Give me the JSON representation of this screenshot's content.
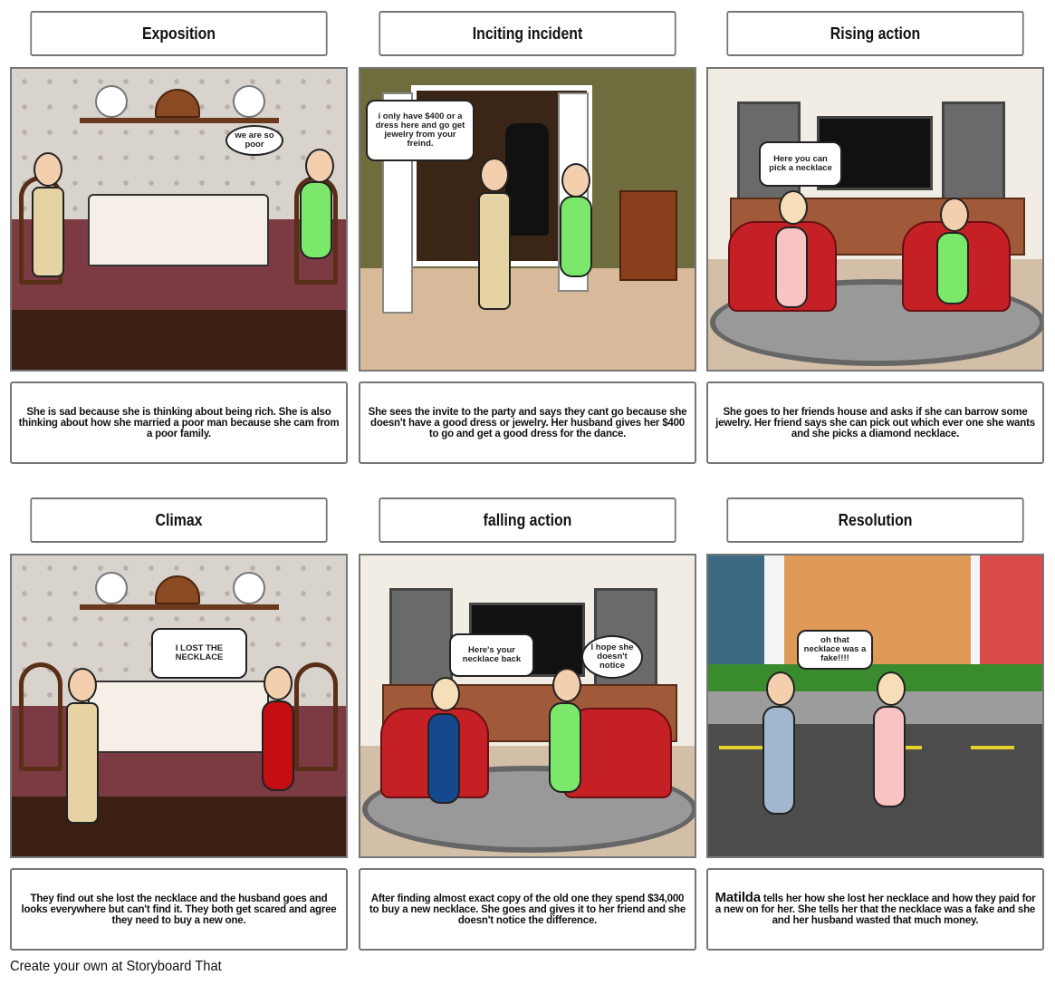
{
  "panels": [
    {
      "title": "Exposition",
      "description": "She is sad because she is thinking about being rich. She is also thinking about how she married a poor man because she cam from a poor family.",
      "bubbles": [
        "we are so poor"
      ]
    },
    {
      "title": "Inciting incident",
      "description": "She sees the invite to the party and says they cant go because she doesn't have a good dress or jewelry.  Her husband gives her $400 to go and get a good dress for the dance.",
      "bubbles": [
        "i only have $400 or a dress here and go get jewelry from your freind."
      ]
    },
    {
      "title": "Rising action",
      "description": "She goes to her friends house and asks if she can barrow some jewelry. Her friend says she can pick out which ever one she wants and she picks a diamond necklace.",
      "bubbles": [
        "Here you can pick a necklace"
      ]
    },
    {
      "title": "Climax",
      "description": "They find out she lost the necklace and the husband goes and looks everywhere but can't find it. They both get scared and agree they need to buy a new one.",
      "bubbles": [
        "I LOST THE NECKLACE"
      ]
    },
    {
      "title": "falling action",
      "description": "After finding almost exact copy of the old one they spend $34,000 to buy a new necklace. She goes and gives it to her friend and she doesn't notice the difference.",
      "bubbles": [
        "Here's your necklace back",
        "I hope she doesn't notice"
      ]
    },
    {
      "title": "Resolution",
      "description_lead": "Matilda",
      "description": " tells her how she lost her necklace and how they paid for a new on for her. She tells her that the necklace was a fake and she and her husband wasted that much money.",
      "bubbles": [
        "oh that necklace was a fake!!!!"
      ]
    }
  ],
  "footer": "Create your own at Storyboard That"
}
